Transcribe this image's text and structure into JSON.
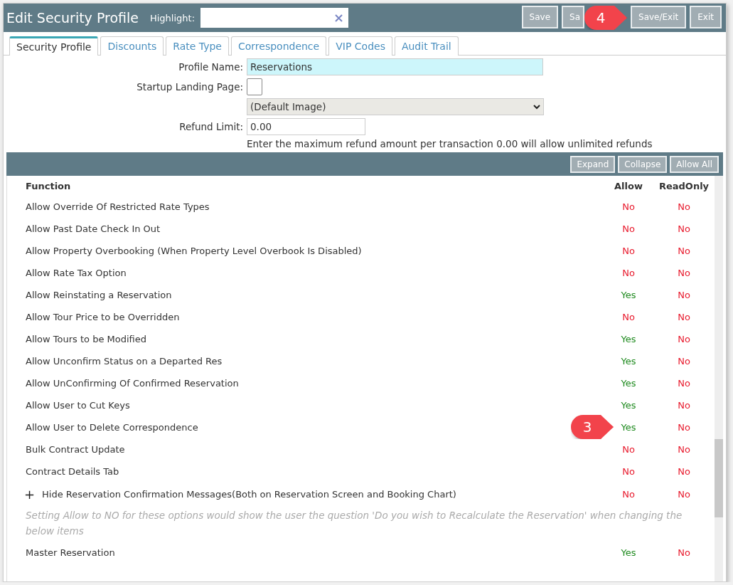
{
  "header": {
    "title": "Edit Security Profile",
    "highlight_label": "Highlight:",
    "buttons": [
      "Save",
      "Sa",
      "Save/Exit",
      "Exit"
    ]
  },
  "tabs": [
    {
      "label": "Security Profile",
      "selected": true
    },
    {
      "label": "Discounts",
      "selected": false
    },
    {
      "label": "Rate Type",
      "selected": false
    },
    {
      "label": "Correspondence",
      "selected": false
    },
    {
      "label": "VIP Codes",
      "selected": false
    },
    {
      "label": "Audit Trail",
      "selected": false
    }
  ],
  "form": {
    "profile_name_label": "Profile Name:",
    "profile_name": "Reservations",
    "startup_label": "Startup Landing Page:",
    "startup_checked": false,
    "image_select": "(Default Image)",
    "refund_label": "Refund Limit:",
    "refund_value": "0.00",
    "refund_hint": "Enter the maximum refund amount per transaction 0.00 will allow unlimited refunds"
  },
  "toolbar": {
    "buttons": [
      "Expand",
      "Collapse",
      "Allow All"
    ]
  },
  "table": {
    "columns": [
      "Function",
      "Allow",
      "ReadOnly"
    ],
    "rows": [
      {
        "kind": "row",
        "function": "Allow Override Of Restricted Rate Types",
        "allow": {
          "text": "No",
          "yes": false
        },
        "readonly": {
          "text": "No",
          "yes": false
        }
      },
      {
        "kind": "row",
        "function": "Allow Past Date Check In Out",
        "allow": {
          "text": "No",
          "yes": false
        },
        "readonly": {
          "text": "No",
          "yes": false
        }
      },
      {
        "kind": "row",
        "function": "Allow Property Overbooking (When Property Level Overbook Is Disabled)",
        "allow": {
          "text": "No",
          "yes": false
        },
        "readonly": {
          "text": "No",
          "yes": false
        }
      },
      {
        "kind": "row",
        "function": "Allow Rate Tax Option",
        "allow": {
          "text": "No",
          "yes": false
        },
        "readonly": {
          "text": "No",
          "yes": false
        }
      },
      {
        "kind": "row",
        "function": "Allow Reinstating a Reservation",
        "allow": {
          "text": "Yes",
          "yes": true
        },
        "readonly": {
          "text": "No",
          "yes": false
        }
      },
      {
        "kind": "row",
        "function": "Allow Tour Price to be Overridden",
        "allow": {
          "text": "No",
          "yes": false
        },
        "readonly": {
          "text": "No",
          "yes": false
        }
      },
      {
        "kind": "row",
        "function": "Allow Tours to be Modified",
        "allow": {
          "text": "Yes",
          "yes": true
        },
        "readonly": {
          "text": "No",
          "yes": false
        }
      },
      {
        "kind": "row",
        "function": "Allow Unconfirm Status on a Departed Res",
        "allow": {
          "text": "Yes",
          "yes": true
        },
        "readonly": {
          "text": "No",
          "yes": false
        }
      },
      {
        "kind": "row",
        "function": "Allow UnConfirming Of Confirmed Reservation",
        "allow": {
          "text": "Yes",
          "yes": true
        },
        "readonly": {
          "text": "No",
          "yes": false
        }
      },
      {
        "kind": "row",
        "function": "Allow User to Cut Keys",
        "allow": {
          "text": "Yes",
          "yes": true
        },
        "readonly": {
          "text": "No",
          "yes": false
        }
      },
      {
        "kind": "row",
        "function": "Allow User to Delete Correspondence",
        "allow": {
          "text": "Yes",
          "yes": true
        },
        "readonly": {
          "text": "No",
          "yes": false
        },
        "callout": "3"
      },
      {
        "kind": "row",
        "function": "Bulk Contract Update",
        "allow": {
          "text": "No",
          "yes": false
        },
        "readonly": {
          "text": "No",
          "yes": false
        }
      },
      {
        "kind": "row",
        "function": "Contract Details Tab",
        "allow": {
          "text": "No",
          "yes": false
        },
        "readonly": {
          "text": "No",
          "yes": false
        }
      },
      {
        "kind": "group",
        "expander": "+",
        "expanded": false,
        "function": "Hide Reservation Confirmation Messages(Both on Reservation Screen and Booking Chart)",
        "allow": {
          "text": "No",
          "yes": false
        },
        "readonly": {
          "text": "No",
          "yes": false
        }
      },
      {
        "kind": "note",
        "text": "Setting Allow to NO for these options would show the user the question 'Do you wish to Recalculate the Reservation' when changing the below items"
      },
      {
        "kind": "row",
        "function": "Master Reservation",
        "allow": {
          "text": "Yes",
          "yes": true
        },
        "readonly": {
          "text": "No",
          "yes": false
        }
      }
    ]
  },
  "callouts": [
    {
      "text": "4"
    }
  ]
}
